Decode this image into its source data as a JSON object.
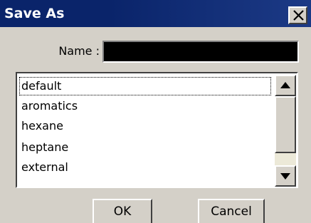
{
  "window": {
    "title": "Save As",
    "close_icon": "close-icon"
  },
  "form": {
    "name_label": "Name :",
    "name_value": ""
  },
  "list": {
    "items": [
      "default",
      "aromatics",
      "hexane",
      "heptane",
      "external"
    ],
    "focused_index": 0
  },
  "scrollbar": {
    "up_icon": "arrow-up-icon",
    "down_icon": "arrow-down-icon"
  },
  "buttons": {
    "ok_label": "OK",
    "cancel_label": "Cancel"
  },
  "colors": {
    "titlebar": "#0a246a",
    "face": "#d4d0c8",
    "name_field": "#000000"
  }
}
